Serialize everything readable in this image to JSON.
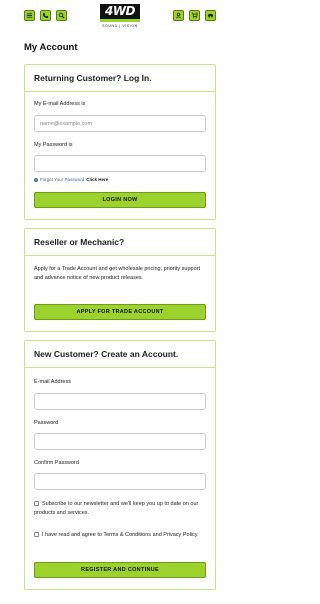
{
  "header": {
    "icons": [
      "menu-icon",
      "phone-icon",
      "search-icon",
      "account-icon",
      "cart-icon",
      "car-icon"
    ],
    "logo_text": "4WD",
    "logo_sub": "SOUND | VISION"
  },
  "page_title": "My Account",
  "login": {
    "title": "Returning Customer? Log In.",
    "email_label": "My E-mail Address is",
    "email_placeholder": "name@example.com",
    "password_label": "My Password is",
    "forgot_text": "Forgot Your Password",
    "forgot_link": "Click Here",
    "button": "LOGIN NOW"
  },
  "reseller": {
    "title": "Reseller or Mechanic?",
    "text": "Apply for a Trade Account and get wholesale pricing, priority support and advance notice of new product releases.",
    "button": "APPLY FOR TRADE ACCOUNT"
  },
  "register": {
    "title": "New Customer? Create an Account.",
    "email_label": "E-mail Address",
    "password_label": "Password",
    "confirm_label": "Confirm Password",
    "newsletter_text": "Subscribe to our newsletter and we'll keep you up to date on our products and services.",
    "terms_text": "I have read and agree to Terms & Conditions and Privacy Policy.",
    "button": "REGISTER AND CONTINUE"
  },
  "colors": {
    "accent": "#9bd22c",
    "border": "#c9e48f"
  }
}
